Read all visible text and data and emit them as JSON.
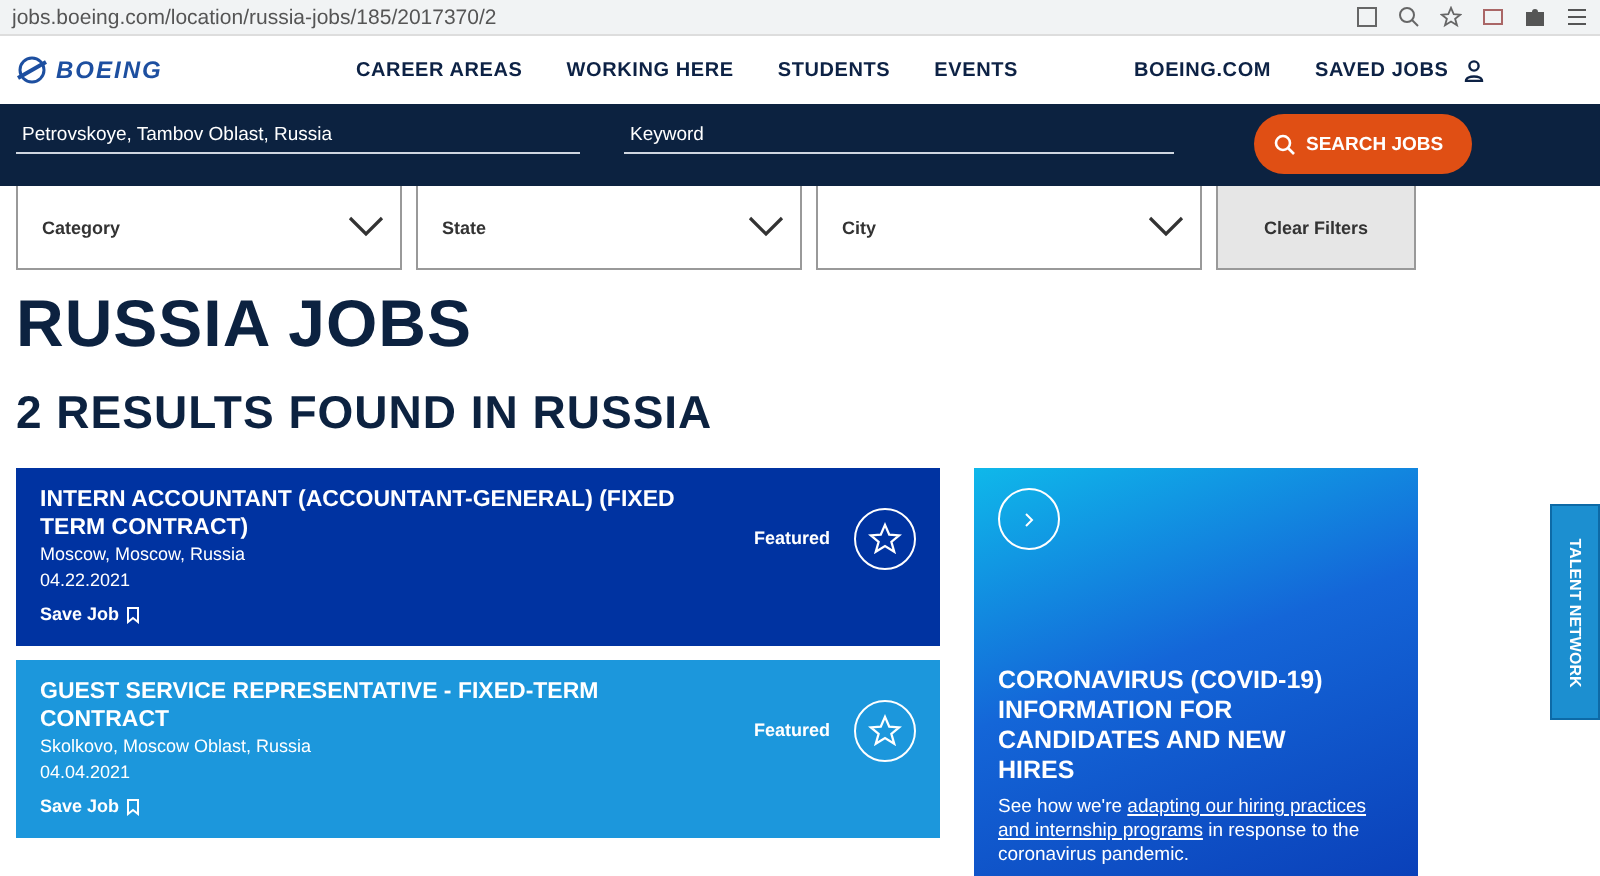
{
  "browser": {
    "url": "jobs.boeing.com/location/russia-jobs/185/2017370/2"
  },
  "nav": {
    "logo": "BOEING",
    "items": [
      "CAREER AREAS",
      "WORKING HERE",
      "STUDENTS",
      "EVENTS",
      "BOEING.COM",
      "SAVED JOBS"
    ]
  },
  "search": {
    "location": "Petrovskoye, Tambov Oblast, Russia",
    "keyword_placeholder": "Keyword",
    "button": "SEARCH JOBS"
  },
  "filters": [
    "Category",
    "State",
    "City"
  ],
  "clear_filters": "Clear Filters",
  "heading": "RUSSIA JOBS",
  "subheading": "2 RESULTS FOUND IN RUSSIA",
  "jobs": [
    {
      "title": "INTERN ACCOUNTANT (ACCOUNTANT-GENERAL) (FIXED TERM CONTRACT)",
      "location": "Moscow, Moscow, Russia",
      "date": "04.22.2021",
      "save": "Save Job",
      "badge": "Featured",
      "color": "#0033a1"
    },
    {
      "title": "GUEST SERVICE REPRESENTATIVE - FIXED-TERM CONTRACT",
      "location": "Skolkovo, Moscow Oblast, Russia",
      "date": "04.04.2021",
      "save": "Save Job",
      "badge": "Featured",
      "color": "#1c97dc"
    }
  ],
  "promo": {
    "title": "CORONAVIRUS (COVID-19) INFORMATION FOR CANDIDATES AND NEW HIRES",
    "text_before": "See how we're ",
    "link_lines": [
      "adapting our hiring practices",
      "and internship programs"
    ],
    "text_after": " in response to the coronavirus pandemic."
  },
  "talent_tab": "TALENT NETWORK"
}
